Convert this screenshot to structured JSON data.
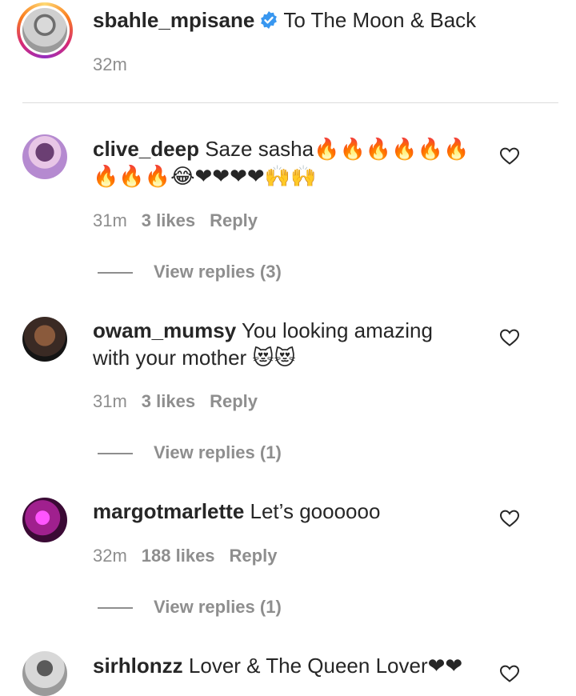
{
  "post": {
    "username": "sbahle_mpisane",
    "caption": "To The Moon & Back",
    "time": "32m",
    "verified_icon": "verified-badge-icon"
  },
  "comments": [
    {
      "username": "clive_deep",
      "text_line1": "Saze sasha🔥🔥🔥🔥🔥🔥",
      "text_line2": "🔥🔥🔥😂❤❤❤❤🙌🙌",
      "time": "31m",
      "likes": "3 likes",
      "reply": "Reply",
      "view_replies": "View replies (3)"
    },
    {
      "username": "owam_mumsy",
      "text_line1": "You looking amazing",
      "text_line2": "with your mother 😻😻",
      "time": "31m",
      "likes": "3 likes",
      "reply": "Reply",
      "view_replies": "View replies (1)"
    },
    {
      "username": "margotmarlette",
      "text_line1": "Let’s goooooo",
      "time": "32m",
      "likes": "188 likes",
      "reply": "Reply",
      "view_replies": "View replies (1)"
    },
    {
      "username": "sirhlonzz",
      "text_line1": "Lover & The Queen Lover❤❤"
    }
  ],
  "colors": {
    "text": "#262626",
    "secondary": "#8e8e8e",
    "verified": "#3897f0",
    "heart_emoji": "#e0102a"
  }
}
